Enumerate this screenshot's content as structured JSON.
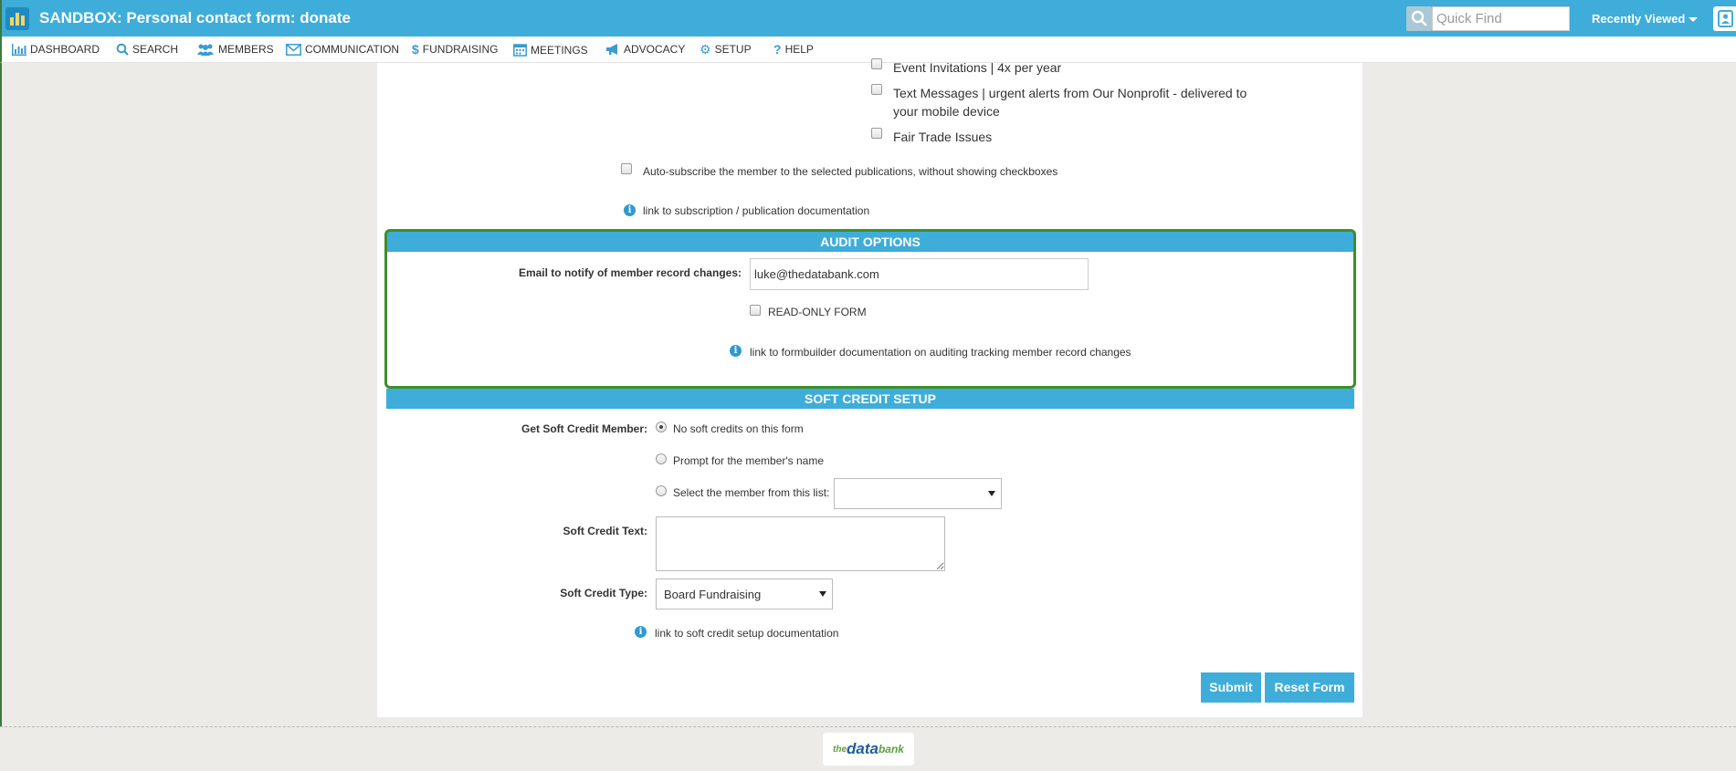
{
  "header": {
    "title": "SANDBOX: Personal contact form: donate",
    "quick_find_placeholder": "Quick Find",
    "recently_viewed": "Recently Viewed"
  },
  "nav": [
    {
      "label": "DASHBOARD",
      "icon": "bar-chart-icon"
    },
    {
      "label": "SEARCH",
      "icon": "search-icon"
    },
    {
      "label": "MEMBERS",
      "icon": "users-icon"
    },
    {
      "label": "COMMUNICATION",
      "icon": "envelope-icon"
    },
    {
      "label": "FUNDRAISING",
      "icon": "dollar-icon"
    },
    {
      "label": "MEETINGS",
      "icon": "calendar-icon"
    },
    {
      "label": "ADVOCACY",
      "icon": "megaphone-icon"
    },
    {
      "label": "SETUP",
      "icon": "gear-icon"
    },
    {
      "label": "HELP",
      "icon": "question-icon"
    }
  ],
  "publications": {
    "items": [
      "Event Invitations | 4x per year",
      "Text Messages | urgent alerts from Our Nonprofit - delivered to",
      "your mobile device",
      "Fair Trade Issues"
    ],
    "auto_subscribe": "Auto-subscribe the member to the selected publications, without showing checkboxes",
    "doc_link": "link to subscription / publication documentation"
  },
  "audit": {
    "header": "AUDIT OPTIONS",
    "email_label": "Email to notify of member record changes:",
    "email_value": "luke@thedatabank.com",
    "readonly_label": "READ-ONLY FORM",
    "doc_link": "link to formbuilder documentation on auditing tracking member record changes"
  },
  "soft_credit": {
    "header": "SOFT CREDIT SETUP",
    "member_label": "Get Soft Credit Member:",
    "options": [
      "No soft credits on this form",
      "Prompt for the member's name",
      "Select the member from this list:"
    ],
    "selected_option": "No soft credits on this form",
    "text_label": "Soft Credit Text:",
    "type_label": "Soft Credit Type:",
    "type_value": "Board Fundraising",
    "doc_link": "link to soft credit setup documentation"
  },
  "buttons": {
    "submit": "Submit",
    "reset": "Reset Form"
  },
  "footer": {
    "logo_the": "the",
    "logo_data": "data",
    "logo_bank": "bank"
  },
  "colors": {
    "accent": "#3fadd9",
    "audit_border": "#3e8e2c",
    "page_bg": "#ecebe7"
  }
}
